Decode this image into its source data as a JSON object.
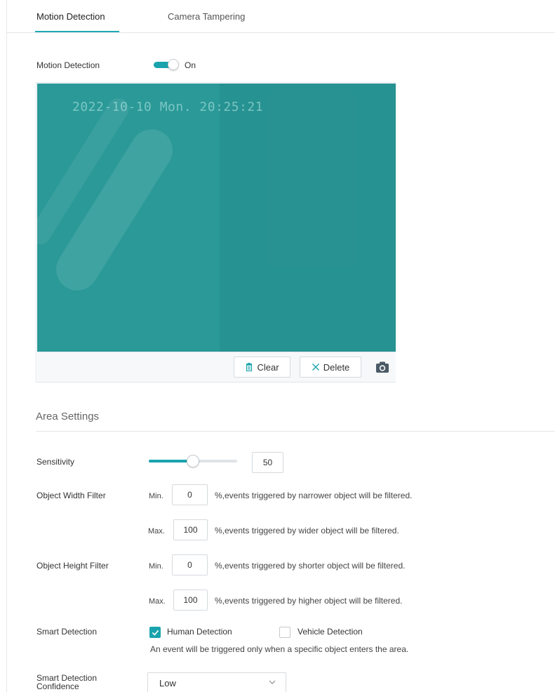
{
  "tabs": [
    {
      "label": "Motion Detection",
      "active": true
    },
    {
      "label": "Camera Tampering",
      "active": false
    }
  ],
  "motion_detection": {
    "label": "Motion Detection",
    "toggle_state": "On",
    "enabled": true
  },
  "video": {
    "osd_text": "2022-10-10 Mon. 20:25:21",
    "clear_label": "Clear",
    "delete_label": "Delete"
  },
  "area_settings": {
    "title": "Area Settings",
    "sensitivity": {
      "label": "Sensitivity",
      "value": "50",
      "level": 0.5
    },
    "width_filter": {
      "label": "Object Width Filter",
      "min_label": "Min.",
      "min_value": "0",
      "min_hint": "%,events triggered by narrower object will be filtered.",
      "max_label": "Max.",
      "max_value": "100",
      "max_hint": "%,events triggered by wider object will be filtered."
    },
    "height_filter": {
      "label": "Object Height Filter",
      "min_label": "Min.",
      "min_value": "0",
      "min_hint": "%,events triggered by shorter object will be filtered.",
      "max_label": "Max.",
      "max_value": "100",
      "max_hint": "%,events triggered by higher object will be filtered."
    },
    "smart_detection": {
      "label": "Smart Detection",
      "human_label": "Human Detection",
      "human_checked": true,
      "vehicle_label": "Vehicle Detection",
      "vehicle_checked": false,
      "note": "An event will be triggered only when a specific object enters the area."
    },
    "confidence": {
      "label_line1": "Smart Detection",
      "label_line2": "Confidence",
      "value": "Low"
    }
  },
  "colors": {
    "accent": "#1aa3ad",
    "video_bg": "#2a9998"
  }
}
